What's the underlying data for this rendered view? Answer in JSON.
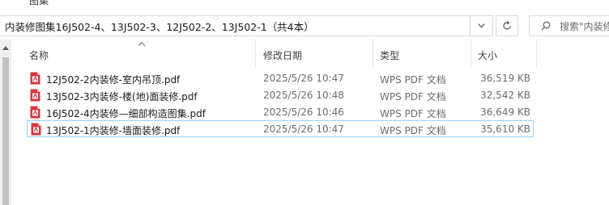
{
  "window": {
    "title_fragment": "图集"
  },
  "address_bar": {
    "path": "内装修图集16J502-4、13J502-3、12J502-2、13J502-1（共4本）"
  },
  "search": {
    "placeholder": "搜索\"内装修"
  },
  "columns": {
    "name": "名称",
    "modified": "修改日期",
    "type": "类型",
    "size": "大小"
  },
  "files": [
    {
      "name": "12J502-2内装修-室内吊顶.pdf",
      "modified": "2025/5/26 10:47",
      "type": "WPS PDF 文档",
      "size": "36,519 KB"
    },
    {
      "name": "13J502-3内装修-楼(地)面装修.pdf",
      "modified": "2025/5/26 10:48",
      "type": "WPS PDF 文档",
      "size": "32,542 KB"
    },
    {
      "name": "16J502-4内装修—细部构造图集.pdf",
      "modified": "2025/5/26 10:46",
      "type": "WPS PDF 文档",
      "size": "36,649 KB"
    },
    {
      "name": "13J502-1内装修-墙面装修.pdf",
      "modified": "2025/5/26 10:47",
      "type": "WPS PDF 文档",
      "size": "35,610 KB"
    }
  ],
  "selected_row": 3,
  "colors": {
    "pdf_icon": "#d9363e",
    "selection_border": "#99d1ff",
    "scrollbar_thumb": "#c2c2c2"
  },
  "icons": [
    "pdf-file-icon",
    "search-icon",
    "chevron-down-icon",
    "refresh-icon",
    "sort-up-arrow-icon",
    "scroll-up-arrow-icon"
  ]
}
